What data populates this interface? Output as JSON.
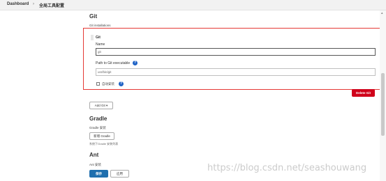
{
  "breadcrumbs": [
    "Dashboard",
    "全局工具配置"
  ],
  "breadcrumb_separator": "›",
  "git": {
    "section_title": "Git",
    "installations_label": "Git installations",
    "installation_title": "Git",
    "name_label": "Name",
    "name_value": "git",
    "path_label": "Path to Git executable",
    "path_value": "usr/bin/git",
    "auto_install_label": "自动安装",
    "delete_button": "Delete Git",
    "add_button": "Add Git",
    "add_button_caret": "▾"
  },
  "gradle": {
    "section_title": "Gradle",
    "installations_label": "Gradle 安装",
    "add_button": "新增 Gradle",
    "hint": "系统下Gradle 安装列表"
  },
  "ant": {
    "section_title": "Ant",
    "installations_label": "Ant 安装",
    "save_button": "保存",
    "apply_button": "应用"
  },
  "help_icon_glyph": "?",
  "watermark": "https://blog.csdn.net/seashouwang",
  "colors": {
    "highlight_border": "#e53935",
    "danger_button": "#d0021b",
    "primary_button": "#1f6fae",
    "help_icon": "#1f63c6"
  }
}
